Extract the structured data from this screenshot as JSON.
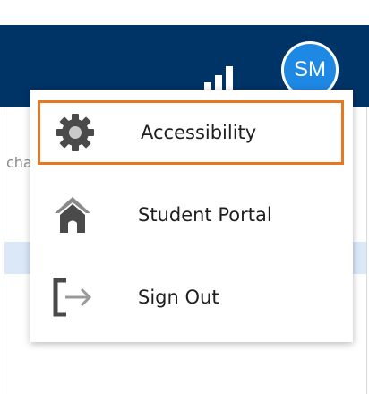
{
  "header": {
    "avatar_initials": "SM",
    "stats_icon": "bar-chart-icon",
    "colors": {
      "background": "#003366",
      "avatar": "#1e88e5"
    }
  },
  "page": {
    "cut_text_fragment": "cha"
  },
  "menu": {
    "items": [
      {
        "label": "Accessibility",
        "icon": "gear-icon",
        "selected": true
      },
      {
        "label": "Student Portal",
        "icon": "home-icon",
        "selected": false
      },
      {
        "label": "Sign Out",
        "icon": "sign-out-icon",
        "selected": false
      }
    ],
    "highlight_color": "#e87722"
  }
}
